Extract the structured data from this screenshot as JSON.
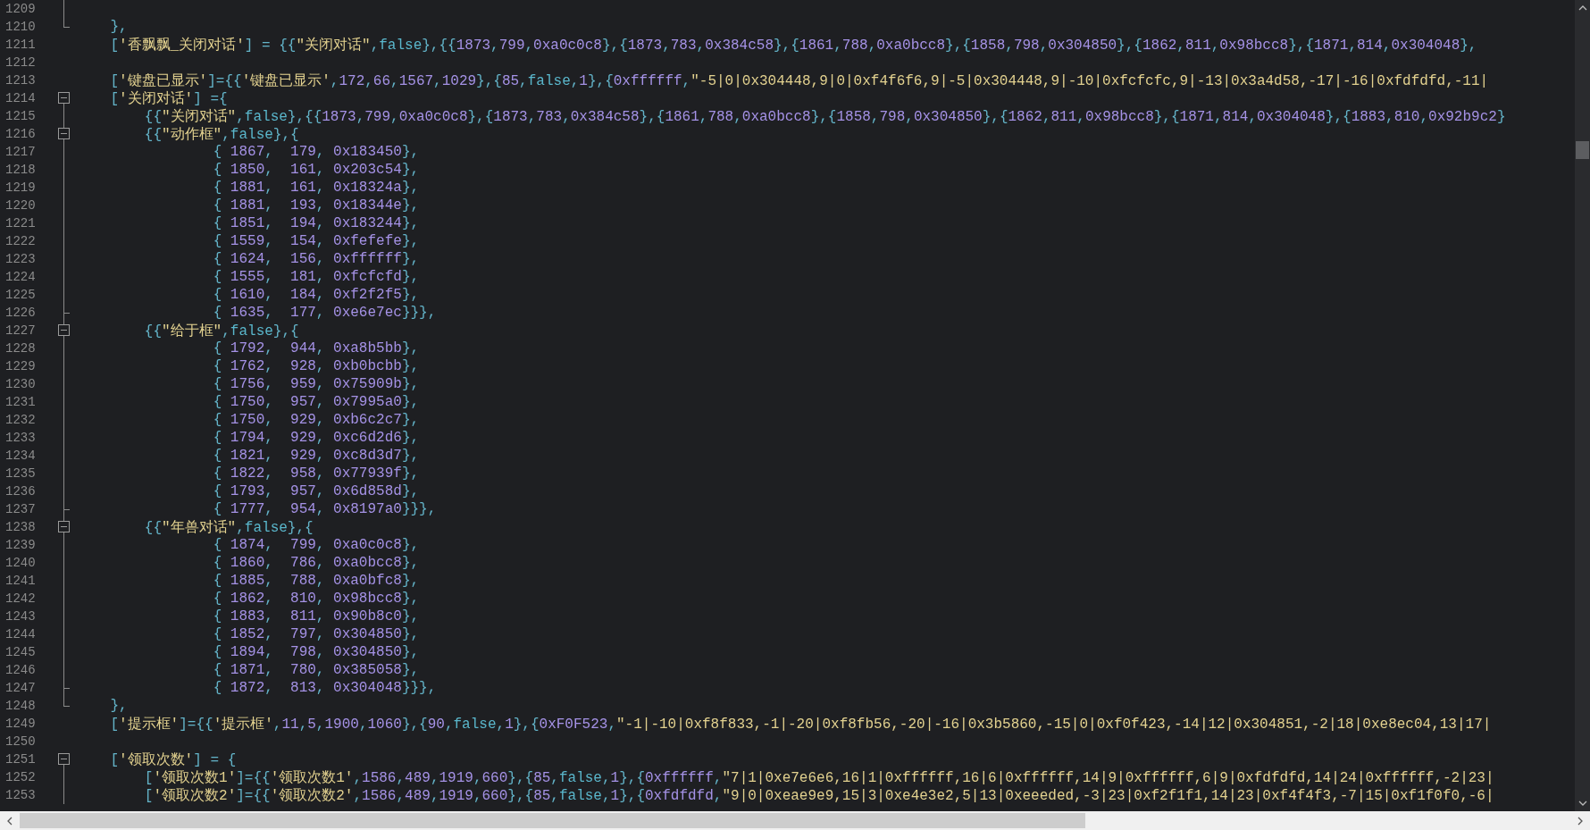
{
  "editor": {
    "lines": [
      {
        "number": "1209",
        "kind": "line"
      },
      {
        "number": "1210",
        "text": "    },",
        "kind": "close"
      },
      {
        "number": "1211",
        "text": "    ['香飘飘_关闭对话'] = {{\"关闭对话\",false},{{1873,799,0xa0c0c8},{1873,783,0x384c58},{1861,788,0xa0bcc8},{1858,798,0x304850},{1862,811,0x98bcc8},{1871,814,0x304048},"
      },
      {
        "number": "1212"
      },
      {
        "number": "1213",
        "text": "    ['键盘已显示']={{'键盘已显示',172,66,1567,1029},{85,false,1},{0xffffff,\"-5|0|0x304448,9|0|0xf4f6f6,9|-5|0x304448,9|-10|0xfcfcfc,9|-13|0x3a4d58,-17|-16|0xfdfdfd,-11|"
      },
      {
        "number": "1214",
        "text": "    ['关闭对话'] ={",
        "kind": "open",
        "expanded": true
      },
      {
        "number": "1215",
        "text": "        {{\"关闭对话\",false},{{1873,799,0xa0c0c8},{1873,783,0x384c58},{1861,788,0xa0bcc8},{1858,798,0x304850},{1862,811,0x98bcc8},{1871,814,0x304048},{1883,810,0x92b9c2}",
        "kind": "line"
      },
      {
        "number": "1216",
        "text": "        {{\"动作框\",false},{",
        "kind": "nested",
        "expanded": true
      },
      {
        "number": "1217",
        "text": "                { 1867,  179, 0x183450},",
        "kind": "line"
      },
      {
        "number": "1218",
        "text": "                { 1850,  161, 0x203c54},",
        "kind": "line"
      },
      {
        "number": "1219",
        "text": "                { 1881,  161, 0x18324a},",
        "kind": "line"
      },
      {
        "number": "1220",
        "text": "                { 1881,  193, 0x18344e},",
        "kind": "line"
      },
      {
        "number": "1221",
        "text": "                { 1851,  194, 0x183244},",
        "kind": "line"
      },
      {
        "number": "1222",
        "text": "                { 1559,  154, 0xfefefe},",
        "kind": "line"
      },
      {
        "number": "1223",
        "text": "                { 1624,  156, 0xffffff},",
        "kind": "line"
      },
      {
        "number": "1224",
        "text": "                { 1555,  181, 0xfcfcfd},",
        "kind": "line"
      },
      {
        "number": "1225",
        "text": "                { 1610,  184, 0xf2f2f5},",
        "kind": "line"
      },
      {
        "number": "1226",
        "text": "                { 1635,  177, 0xe6e7ec}}},",
        "kind": "branch"
      },
      {
        "number": "1227",
        "text": "        {{\"给于框\",false},{",
        "kind": "nested",
        "expanded": true
      },
      {
        "number": "1228",
        "text": "                { 1792,  944, 0xa8b5bb},",
        "kind": "line"
      },
      {
        "number": "1229",
        "text": "                { 1762,  928, 0xb0bcbb},",
        "kind": "line"
      },
      {
        "number": "1230",
        "text": "                { 1756,  959, 0x75909b},",
        "kind": "line"
      },
      {
        "number": "1231",
        "text": "                { 1750,  957, 0x7995a0},",
        "kind": "line"
      },
      {
        "number": "1232",
        "text": "                { 1750,  929, 0xb6c2c7},",
        "kind": "line"
      },
      {
        "number": "1233",
        "text": "                { 1794,  929, 0xc6d2d6},",
        "kind": "line"
      },
      {
        "number": "1234",
        "text": "                { 1821,  929, 0xc8d3d7},",
        "kind": "line"
      },
      {
        "number": "1235",
        "text": "                { 1822,  958, 0x77939f},",
        "kind": "line"
      },
      {
        "number": "1236",
        "text": "                { 1793,  957, 0x6d858d},",
        "kind": "line"
      },
      {
        "number": "1237",
        "text": "                { 1777,  954, 0x8197a0}}},",
        "kind": "branch"
      },
      {
        "number": "1238",
        "text": "        {{\"年兽对话\",false},{",
        "kind": "nested",
        "expanded": true
      },
      {
        "number": "1239",
        "text": "                { 1874,  799, 0xa0c0c8},",
        "kind": "line"
      },
      {
        "number": "1240",
        "text": "                { 1860,  786, 0xa0bcc8},",
        "kind": "line"
      },
      {
        "number": "1241",
        "text": "                { 1885,  788, 0xa0bfc8},",
        "kind": "line"
      },
      {
        "number": "1242",
        "text": "                { 1862,  810, 0x98bcc8},",
        "kind": "line"
      },
      {
        "number": "1243",
        "text": "                { 1883,  811, 0x90b8c0},",
        "kind": "line"
      },
      {
        "number": "1244",
        "text": "                { 1852,  797, 0x304850},",
        "kind": "line"
      },
      {
        "number": "1245",
        "text": "                { 1894,  798, 0x304850},",
        "kind": "line"
      },
      {
        "number": "1246",
        "text": "                { 1871,  780, 0x385058},",
        "kind": "line"
      },
      {
        "number": "1247",
        "text": "                { 1872,  813, 0x304048}}},",
        "kind": "branch"
      },
      {
        "number": "1248",
        "text": "    },",
        "kind": "close"
      },
      {
        "number": "1249",
        "text": "    ['提示框']={{'提示框',11,5,1900,1060},{90,false,1},{0xF0F523,\"-1|-10|0xf8f833,-1|-20|0xf8fb56,-20|-16|0x3b5860,-15|0|0xf0f423,-14|12|0x304851,-2|18|0xe8ec04,13|17|"
      },
      {
        "number": "1250"
      },
      {
        "number": "1251",
        "text": "    ['领取次数'] = {",
        "kind": "open",
        "expanded": true
      },
      {
        "number": "1252",
        "text": "        ['领取次数1']={{'领取次数1',1586,489,1919,660},{85,false,1},{0xffffff,\"7|1|0xe7e6e6,16|1|0xffffff,16|6|0xffffff,14|9|0xffffff,6|9|0xfdfdfd,14|24|0xffffff,-2|23|",
        "kind": "line"
      },
      {
        "number": "1253",
        "text": "        ['领取次数2']={{'领取次数2',1586,489,1919,660},{85,false,1},{0xfdfdfd,\"9|0|0xeae9e9,15|3|0xe4e3e2,5|13|0xeeeded,-3|23|0xf2f1f1,14|23|0xf4f4f3,-7|15|0xf1f0f0,-6|",
        "kind": "line"
      }
    ]
  }
}
